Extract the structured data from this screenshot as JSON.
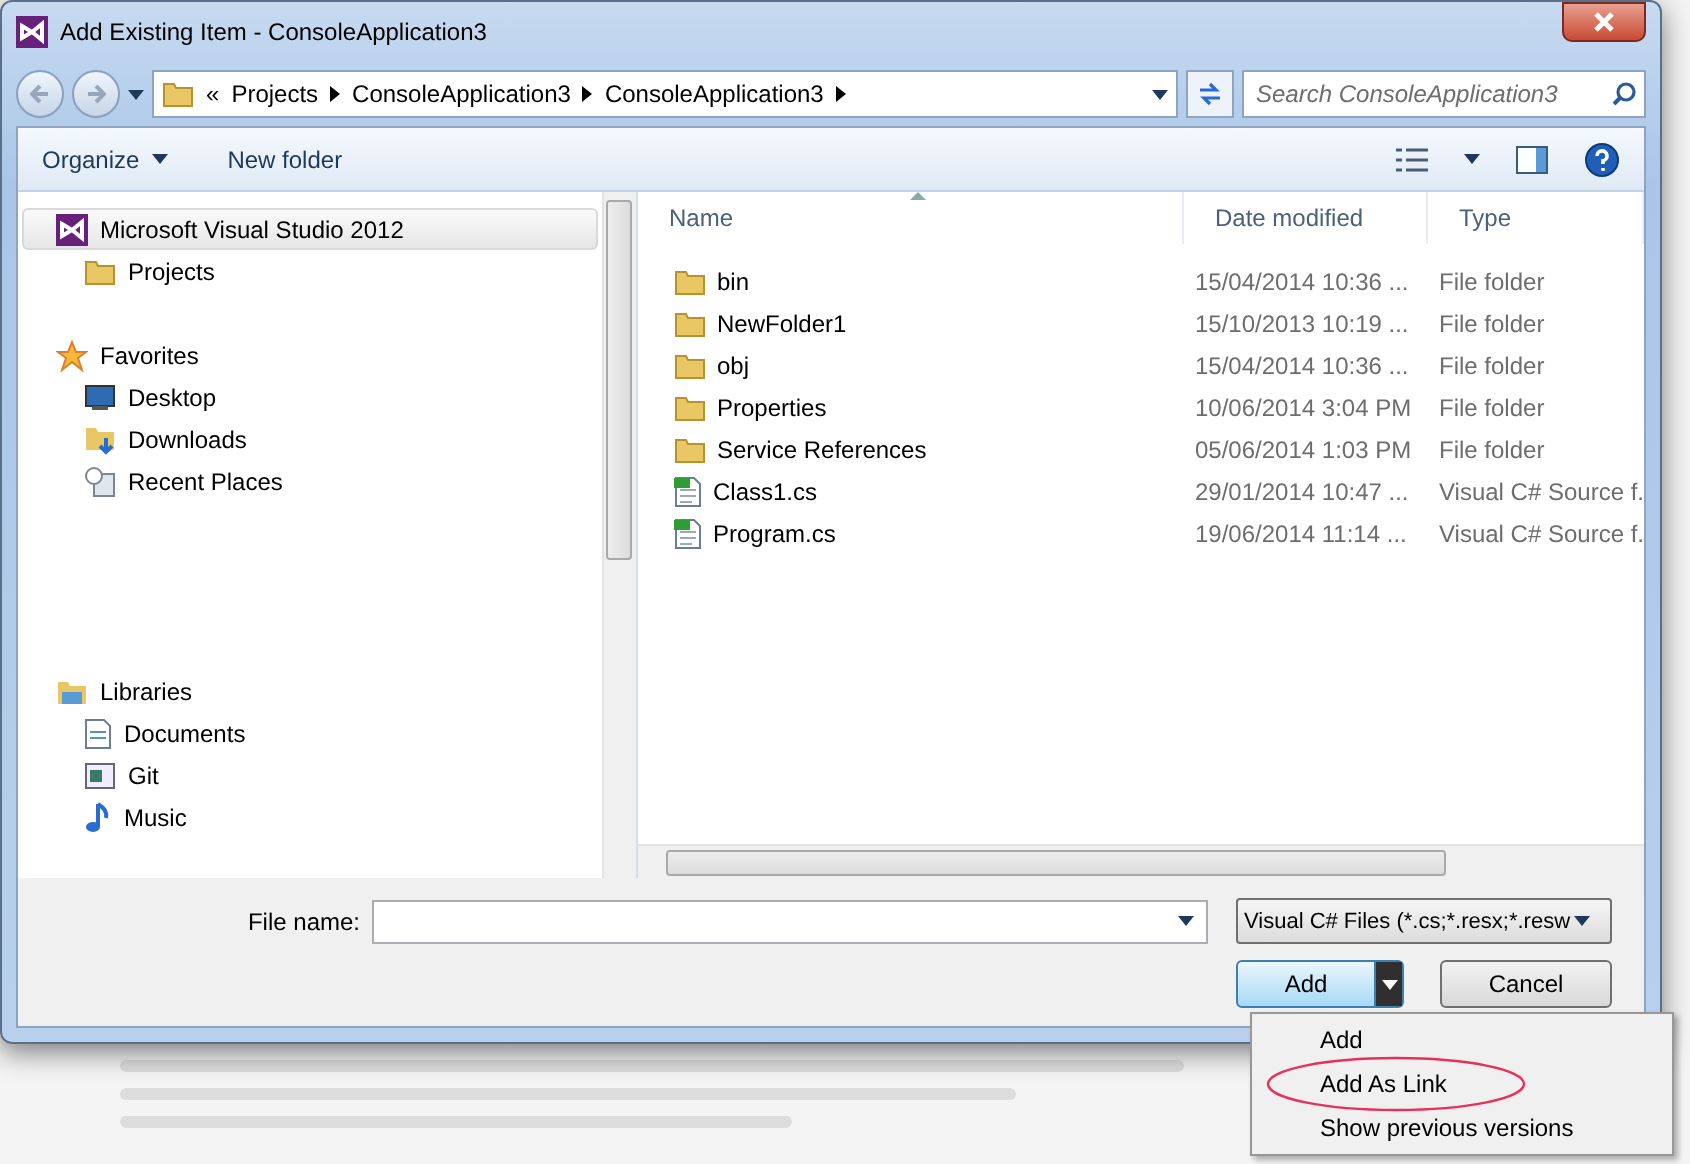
{
  "window": {
    "title": "Add Existing Item - ConsoleApplication3"
  },
  "address": {
    "overflow": "«",
    "path": [
      "Projects",
      "ConsoleApplication3",
      "ConsoleApplication3"
    ]
  },
  "search": {
    "placeholder": "Search ConsoleApplication3"
  },
  "toolbar": {
    "items": [
      "Organize",
      "New folder"
    ]
  },
  "nav_pane": {
    "items": [
      {
        "label": "Microsoft Visual Studio 2012",
        "kind": "vs",
        "selected": true,
        "children": [
          {
            "label": "Projects",
            "kind": "folder",
            "selected": false
          }
        ]
      },
      {
        "label": "Favorites",
        "kind": "star",
        "selected": false,
        "children": [
          {
            "label": "Desktop",
            "kind": "desktop",
            "selected": false
          },
          {
            "label": "Downloads",
            "kind": "downloads",
            "selected": false
          },
          {
            "label": "Recent Places",
            "kind": "recent",
            "selected": false
          }
        ]
      },
      {
        "label": "Libraries",
        "kind": "library",
        "selected": false,
        "children": [
          {
            "label": "Documents",
            "kind": "document",
            "selected": false
          },
          {
            "label": "Git",
            "kind": "window",
            "selected": false
          },
          {
            "label": "Music",
            "kind": "music",
            "selected": false
          }
        ]
      }
    ]
  },
  "file_list": {
    "columns": [
      {
        "label": "Name",
        "sorted": true
      },
      {
        "label": "Date modified",
        "sorted": false
      },
      {
        "label": "Type",
        "sorted": false
      }
    ],
    "rows": [
      {
        "name": "bin",
        "date": "15/04/2014 10:36 ...",
        "type": "File folder",
        "kind": "folder"
      },
      {
        "name": "NewFolder1",
        "date": "15/10/2013 10:19 ...",
        "type": "File folder",
        "kind": "folder"
      },
      {
        "name": "obj",
        "date": "15/04/2014 10:36 ...",
        "type": "File folder",
        "kind": "folder"
      },
      {
        "name": "Properties",
        "date": "10/06/2014 3:04 PM",
        "type": "File folder",
        "kind": "folder"
      },
      {
        "name": "Service References",
        "date": "05/06/2014 1:03 PM",
        "type": "File folder",
        "kind": "folder"
      },
      {
        "name": "Class1.cs",
        "date": "29/01/2014 10:47 ...",
        "type": "Visual C# Source f.",
        "kind": "csharp"
      },
      {
        "name": "Program.cs",
        "date": "19/06/2014 11:14 ...",
        "type": "Visual C# Source f.",
        "kind": "csharp"
      }
    ]
  },
  "file_name": {
    "label": "File name:"
  },
  "filter": {
    "value": "Visual C# Files (*.cs;*.resx;*.resw"
  },
  "buttons": [
    {
      "label": "Add",
      "kind": "split"
    },
    {
      "label": "Cancel",
      "kind": "plain"
    }
  ],
  "menu": {
    "items": [
      {
        "label": "Add",
        "annotated": false
      },
      {
        "label": "Add As Link",
        "annotated": true
      },
      {
        "label": "Show previous versions",
        "annotated": false
      }
    ]
  }
}
